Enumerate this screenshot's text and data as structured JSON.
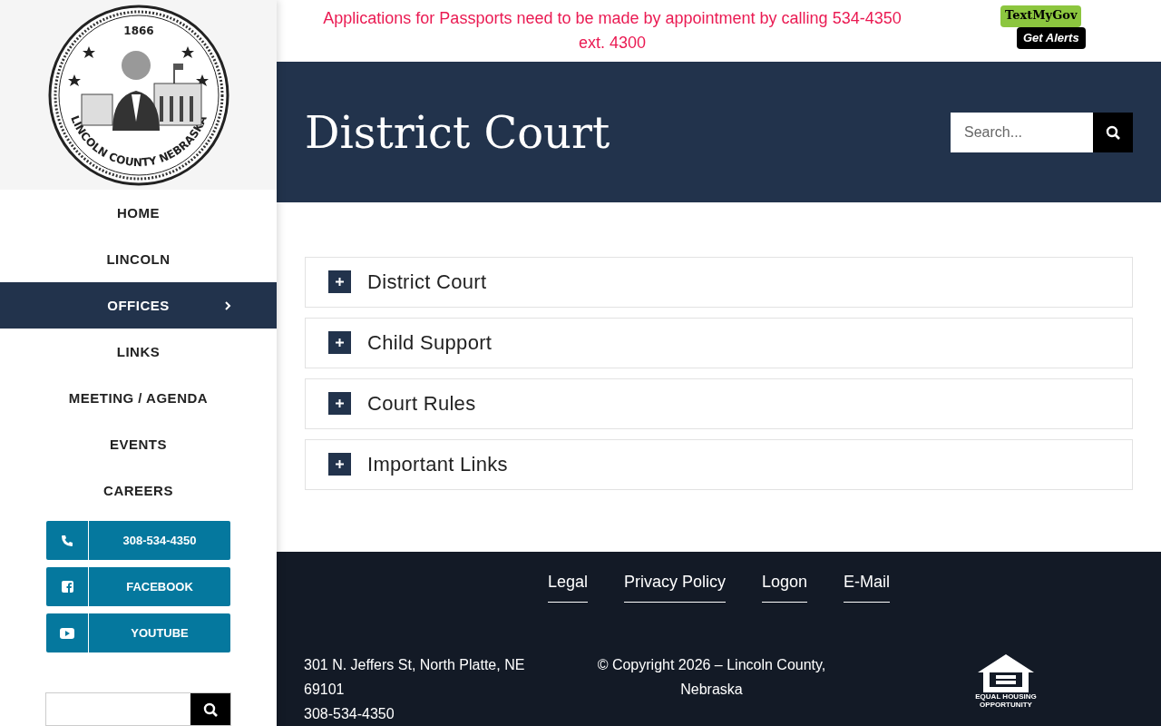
{
  "logo": {
    "year": "1866",
    "motto": "LINCOLN COUNTY NEBRASKA"
  },
  "nav": [
    {
      "label": "HOME",
      "selected": false,
      "has_submenu": false
    },
    {
      "label": "LINCOLN",
      "selected": false,
      "has_submenu": false
    },
    {
      "label": "OFFICES",
      "selected": true,
      "has_submenu": true
    },
    {
      "label": "LINKS",
      "selected": false,
      "has_submenu": false
    },
    {
      "label": "MEETING / AGENDA",
      "selected": false,
      "has_submenu": false
    },
    {
      "label": "EVENTS",
      "selected": false,
      "has_submenu": false
    },
    {
      "label": "CAREERS",
      "selected": false,
      "has_submenu": false
    }
  ],
  "contact_buttons": [
    {
      "kind": "phone",
      "label": "308-534-4350"
    },
    {
      "kind": "facebook",
      "label": "FACEBOOK"
    },
    {
      "kind": "youtube",
      "label": "YOUTUBE"
    }
  ],
  "notice": "Applications for Passports need to be made by appointment by calling 534-4350 ext. 4300",
  "alerts_badge": {
    "top": "TextMyGov",
    "bottom": "Get Alerts"
  },
  "page_title": "District Court",
  "search": {
    "placeholder": "Search..."
  },
  "accordion": [
    {
      "title": "District Court",
      "expanded": false
    },
    {
      "title": "Child Support",
      "expanded": false
    },
    {
      "title": "Court Rules",
      "expanded": false
    },
    {
      "title": "Important Links",
      "expanded": false
    }
  ],
  "footer": {
    "links": [
      "Legal",
      "Privacy Policy",
      "Logon",
      "E-Mail"
    ],
    "address": [
      "301 N. Jeffers St, North Platte, NE 69101",
      "308-534-4350"
    ],
    "copyright": "© Copyright 2026 – Lincoln County, Nebraska",
    "housing_logo": "EQUAL HOUSING OPPORTUNITY"
  }
}
